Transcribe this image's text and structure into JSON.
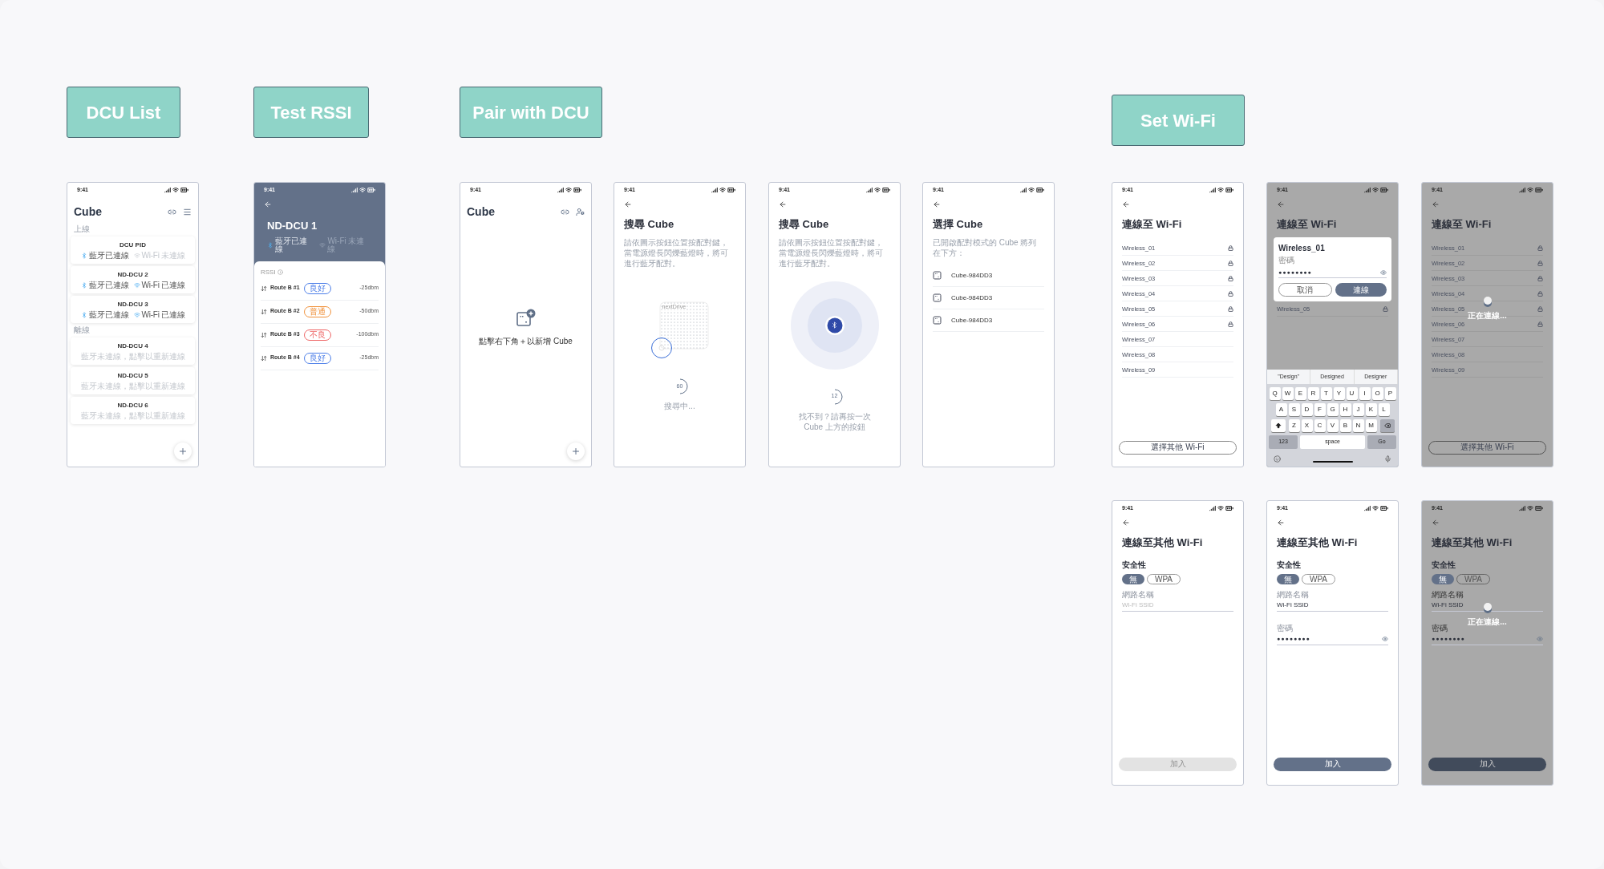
{
  "canvas": {
    "section_labels": [
      {
        "text": "DCU List"
      },
      {
        "text": "Test RSSI"
      },
      {
        "text": "Pair with DCU"
      },
      {
        "text": "Set Wi-Fi"
      }
    ],
    "screens": [
      {
        "kind": "dcu_list",
        "time": "9:41",
        "title": "Cube",
        "groups": [
          {
            "label": "上線",
            "devices": [
              {
                "kind": "online",
                "name": "DCU PID",
                "bluetooth": "藍牙已連線",
                "bluetooth_connected": true,
                "wifi": "Wi-Fi 未連線",
                "wifi_connected": false
              },
              {
                "kind": "online",
                "name": "ND-DCU 2",
                "bluetooth": "藍牙已連線",
                "bluetooth_connected": true,
                "wifi": "Wi-Fi 已連線",
                "wifi_connected": true
              },
              {
                "kind": "online",
                "name": "ND-DCU 3",
                "bluetooth": "藍牙已連線",
                "bluetooth_connected": true,
                "wifi": "Wi-Fi 已連線",
                "wifi_connected": true
              }
            ]
          },
          {
            "label": "離線",
            "devices": [
              {
                "kind": "offline",
                "name": "ND-DCU 4",
                "status": "藍牙未連線，點擊以重新連線"
              },
              {
                "kind": "offline",
                "name": "ND-DCU 5",
                "status": "藍牙未連線，點擊以重新連線"
              },
              {
                "kind": "offline",
                "name": "ND-DCU 6",
                "status": "藍牙未連線，點擊以重新連線"
              }
            ]
          }
        ]
      },
      {
        "kind": "rssi",
        "time": "9:41",
        "title": "ND-DCU 1",
        "bluetooth": "藍牙已連線",
        "bluetooth_connected": true,
        "wifi": "Wi-Fi 未連線",
        "wifi_connected": false,
        "section": "RSSI",
        "routes": [
          {
            "name": "Route B #1",
            "quality": "良好",
            "color": "#4c7ee8",
            "reading": "-25dbm"
          },
          {
            "name": "Route B #2",
            "quality": "普通",
            "color": "#f0913a",
            "reading": "-50dbm"
          },
          {
            "name": "Route B #3",
            "quality": "不良",
            "color": "#ee6464",
            "reading": "-100dbm"
          },
          {
            "name": "Route B #4",
            "quality": "良好",
            "color": "#4c7ee8",
            "reading": "-25dbm"
          }
        ]
      },
      {
        "kind": "pair_empty",
        "time": "9:41",
        "title": "Cube",
        "hint": "點擊右下角＋以新增 Cube"
      },
      {
        "kind": "searching",
        "time": "9:41",
        "title": "搜尋 Cube",
        "description": "請依圖示按鈕位置按配對鍵，當電源燈長閃爍藍燈時，將可進行藍牙配對。",
        "device_label": "nextDrive",
        "countdown": "60",
        "status_lines": [
          "搜尋中..."
        ]
      },
      {
        "kind": "searching_bt",
        "time": "9:41",
        "title": "搜尋 Cube",
        "description": "請依圖示按鈕位置按配對鍵，當電源燈長閃爍藍燈時，將可進行藍牙配對。",
        "countdown": "12",
        "status_lines": [
          "找不到？請再按一次",
          "Cube 上方的按鈕"
        ]
      },
      {
        "kind": "select_cube",
        "time": "9:41",
        "title": "選擇 Cube",
        "description": "已開啟配對模式的 Cube 將列在下方：",
        "devices": [
          "Cube-984DD3",
          "Cube-984DD3",
          "Cube-984DD3"
        ]
      },
      {
        "kind": "wifi_list",
        "dimmed": false,
        "time": "9:41",
        "title": "連線至 Wi-Fi",
        "networks": [
          {
            "name": "Wireless_01",
            "locked": true
          },
          {
            "name": "Wireless_02",
            "locked": true
          },
          {
            "name": "Wireless_03",
            "locked": true
          },
          {
            "name": "Wireless_04",
            "locked": true
          },
          {
            "name": "Wireless_05",
            "locked": true
          },
          {
            "name": "Wireless_06",
            "locked": true
          },
          {
            "name": "Wireless_07",
            "locked": false
          },
          {
            "name": "Wireless_08",
            "locked": false
          },
          {
            "name": "Wireless_09",
            "locked": false
          }
        ],
        "button": "選擇其他 Wi-Fi"
      },
      {
        "kind": "wifi_password",
        "dimmed": true,
        "time": "9:41",
        "title": "連線至 Wi-Fi",
        "dialog": {
          "title": "Wireless_01",
          "field_label": "密碼",
          "value": "●●●●●●●●",
          "buttons": [
            {
              "label": "取消",
              "kind": "secondary"
            },
            {
              "label": "連線",
              "kind": "primary"
            }
          ]
        },
        "networks": [
          {
            "name": "Wireless_05",
            "locked": true
          }
        ],
        "keyboard": {
          "suggestions": [
            "\"Design\"",
            "Designed",
            "Designer"
          ],
          "rows": [
            [
              "Q",
              "W",
              "E",
              "R",
              "T",
              "Y",
              "U",
              "I",
              "O",
              "P"
            ],
            [
              "A",
              "S",
              "D",
              "F",
              "G",
              "H",
              "J",
              "K",
              "L"
            ],
            [
              "Z",
              "X",
              "C",
              "V",
              "B",
              "N",
              "M"
            ]
          ],
          "number_key": "123",
          "space_key": "space",
          "go_key": "Go"
        }
      },
      {
        "kind": "wifi_list",
        "dimmed": true,
        "time": "9:41",
        "title": "連線至 Wi-Fi",
        "networks": [
          {
            "name": "Wireless_01",
            "locked": true
          },
          {
            "name": "Wireless_02",
            "locked": true
          },
          {
            "name": "Wireless_03",
            "locked": true
          },
          {
            "name": "Wireless_04",
            "locked": true
          },
          {
            "name": "Wireless_05",
            "locked": true
          },
          {
            "name": "Wireless_06",
            "locked": true
          },
          {
            "name": "Wireless_07",
            "locked": false
          },
          {
            "name": "Wireless_08",
            "locked": false
          },
          {
            "name": "Wireless_09",
            "locked": false
          }
        ],
        "button": "選擇其他 Wi-Fi",
        "loading": "正在連線..."
      },
      {
        "kind": "other_wifi",
        "dimmed": false,
        "time": "9:41",
        "title": "連線至其他 Wi-Fi",
        "security_label": "安全性",
        "security_options": [
          {
            "label": "無",
            "selected": true
          },
          {
            "label": "WPA",
            "selected": false
          }
        ],
        "ssid": {
          "label": "網路名稱",
          "placeholder": "Wi-Fi SSID"
        },
        "join_button": {
          "label": "加入",
          "disabled": true
        }
      },
      {
        "kind": "other_wifi",
        "dimmed": false,
        "time": "9:41",
        "title": "連線至其他 Wi-Fi",
        "security_label": "安全性",
        "security_options": [
          {
            "label": "無",
            "selected": true
          },
          {
            "label": "WPA",
            "selected": false
          }
        ],
        "ssid": {
          "label": "網路名稱",
          "value": "Wi-Fi SSID"
        },
        "password": {
          "label": "密碼",
          "value": "●●●●●●●●"
        },
        "join_button": {
          "label": "加入",
          "disabled": false
        }
      },
      {
        "kind": "other_wifi",
        "dimmed": true,
        "time": "9:41",
        "title": "連線至其他 Wi-Fi",
        "security_label": "安全性",
        "security_options": [
          {
            "label": "無",
            "selected": true
          },
          {
            "label": "WPA",
            "selected": false
          }
        ],
        "ssid": {
          "label": "網路名稱",
          "value": "Wi-Fi SSID"
        },
        "password": {
          "label": "密碼",
          "value": "●●●●●●●●"
        },
        "join_button": {
          "label": "加入",
          "disabled": false
        },
        "loading": "正在連線..."
      }
    ]
  }
}
